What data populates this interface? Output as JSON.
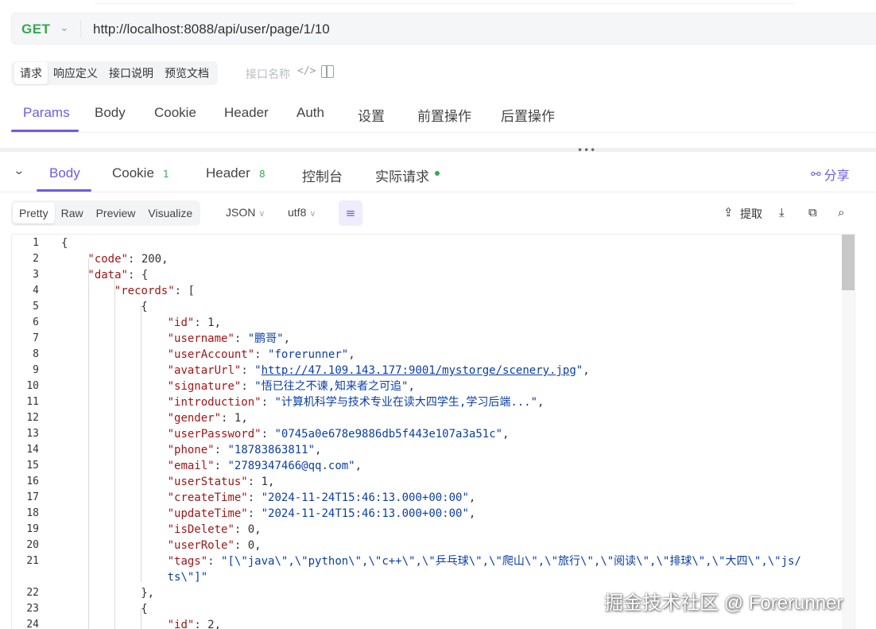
{
  "request": {
    "method": "GET",
    "url": "http://localhost:8088/api/user/page/1/10"
  },
  "doc_tabs": [
    "请求",
    "响应定义",
    "接口说明",
    "预览文档"
  ],
  "doc_name_placeholder": "接口名称",
  "request_tabs": [
    "Params",
    "Body",
    "Cookie",
    "Header",
    "Auth",
    "设置",
    "前置操作",
    "后置操作"
  ],
  "response_tabs": {
    "body": "Body",
    "cookie": "Cookie",
    "cookie_count": "1",
    "header": "Header",
    "header_count": "8",
    "console": "控制台",
    "actual": "实际请求"
  },
  "share_label": "分享",
  "format_tabs": [
    "Pretty",
    "Raw",
    "Preview",
    "Visualize"
  ],
  "format_select": "JSON",
  "encoding_select": "utf8",
  "extract_label": "提取",
  "editor": {
    "lines": [
      {
        "n": "1",
        "t": "{"
      },
      {
        "n": "2",
        "k": "\"code\"",
        "r": ": 200,"
      },
      {
        "n": "3",
        "k": "\"data\"",
        "r": ": {"
      },
      {
        "n": "4",
        "k": "\"records\"",
        "r": ": ["
      },
      {
        "n": "5",
        "t": "{"
      },
      {
        "n": "6",
        "k": "\"id\"",
        "r": ": 1,"
      },
      {
        "n": "7",
        "k": "\"username\"",
        "s": "\"鹏哥\"",
        "r": ","
      },
      {
        "n": "8",
        "k": "\"userAccount\"",
        "s": "\"forerunner\"",
        "r": ","
      },
      {
        "n": "9",
        "k": "\"avatarUrl\"",
        "s": "\"http://47.109.143.177:9001/mystorge/scenery.jpg\"",
        "r": ","
      },
      {
        "n": "10",
        "k": "\"signature\"",
        "s": "\"悟已往之不谏,知来者之可追\"",
        "r": ","
      },
      {
        "n": "11",
        "k": "\"introduction\"",
        "s": "\"计算机科学与技术专业在读大四学生,学习后端...\"",
        "r": ","
      },
      {
        "n": "12",
        "k": "\"gender\"",
        "r": ": 1,"
      },
      {
        "n": "13",
        "k": "\"userPassword\"",
        "s": "\"0745a0e678e9886db5f443e107a3a51c\"",
        "r": ","
      },
      {
        "n": "14",
        "k": "\"phone\"",
        "s": "\"18783863811\"",
        "r": ","
      },
      {
        "n": "15",
        "k": "\"email\"",
        "s": "\"2789347466@qq.com\"",
        "r": ","
      },
      {
        "n": "16",
        "k": "\"userStatus\"",
        "r": ": 1,"
      },
      {
        "n": "17",
        "k": "\"createTime\"",
        "s": "\"2024-11-24T15:46:13.000+00:00\"",
        "r": ","
      },
      {
        "n": "18",
        "k": "\"updateTime\"",
        "s": "\"2024-11-24T15:46:13.000+00:00\"",
        "r": ","
      },
      {
        "n": "19",
        "k": "\"isDelete\"",
        "r": ": 0,"
      },
      {
        "n": "20",
        "k": "\"userRole\"",
        "r": ": 0,"
      },
      {
        "n": "21",
        "k": "\"tags\"",
        "s": "\"[\\\"java\\\",\\\"python\\\",\\\"c++\\\",\\\"乒乓球\\\",\\\"爬山\\\",\\\"旅行\\\",\\\"阅读\\\",\\\"排球\\\",\\\"大四\\\",\\\"js/",
        "s2": "ts\\\"]\""
      },
      {
        "n": "22",
        "t": "},"
      },
      {
        "n": "23",
        "t": "{"
      },
      {
        "n": "24",
        "k": "\"id\"",
        "r": ": 2,"
      }
    ]
  },
  "watermark": "掘金技术社区 @ Forerunner"
}
